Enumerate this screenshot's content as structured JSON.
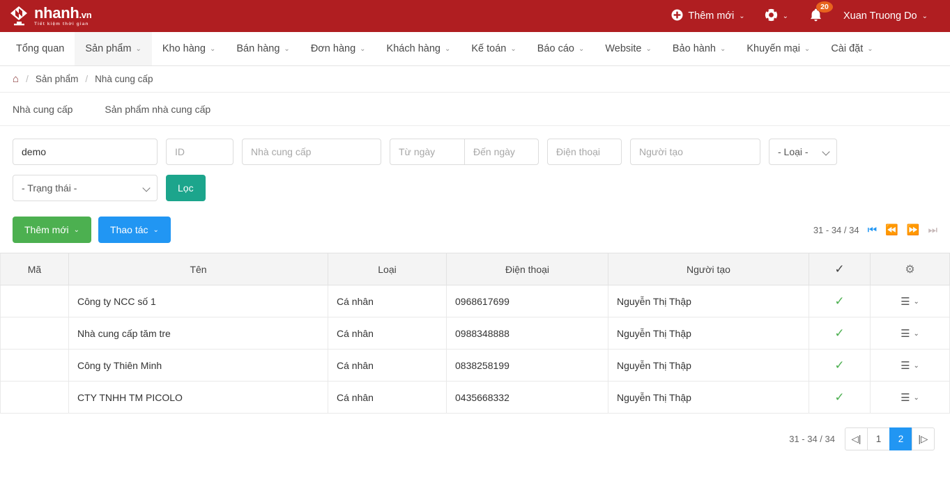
{
  "brand": {
    "name": "nhanh",
    "tld": ".vn",
    "tagline": "Tiết kiệm thời gian",
    "header_color": "#b01e21"
  },
  "header": {
    "add_new_label": "Thêm mới",
    "help_icon": "lifebuoy-icon",
    "bell_icon": "bell-icon",
    "notification_count": "20",
    "user_name": "Xuan Truong Do",
    "badge_color": "#e8641e"
  },
  "mainnav": {
    "items": [
      {
        "label": "Tổng quan",
        "has_caret": false,
        "active": false
      },
      {
        "label": "Sản phẩm",
        "has_caret": true,
        "active": true
      },
      {
        "label": "Kho hàng",
        "has_caret": true,
        "active": false
      },
      {
        "label": "Bán hàng",
        "has_caret": true,
        "active": false
      },
      {
        "label": "Đơn hàng",
        "has_caret": true,
        "active": false
      },
      {
        "label": "Khách hàng",
        "has_caret": true,
        "active": false
      },
      {
        "label": "Kế toán",
        "has_caret": true,
        "active": false
      },
      {
        "label": "Báo cáo",
        "has_caret": true,
        "active": false
      },
      {
        "label": "Website",
        "has_caret": true,
        "active": false
      },
      {
        "label": "Bảo hành",
        "has_caret": true,
        "active": false
      },
      {
        "label": "Khuyến mại",
        "has_caret": true,
        "active": false
      },
      {
        "label": "Cài đặt",
        "has_caret": true,
        "active": false
      }
    ]
  },
  "breadcrumb": {
    "home_icon": "home-icon",
    "sep": "/",
    "item1": "Sản phẩm",
    "item2": "Nhà cung cấp"
  },
  "subtabs": {
    "tab1": "Nhà cung cấp",
    "tab2": "Sản phẩm nhà cung cấp"
  },
  "filters": {
    "keyword_value": "demo",
    "keyword_placeholder": "",
    "id_placeholder": "ID",
    "supplier_placeholder": "Nhà cung cấp",
    "from_date_placeholder": "Từ ngày",
    "to_date_placeholder": "Đến ngày",
    "phone_placeholder": "Điện thoại",
    "creator_placeholder": "Người tạo",
    "type_selected": "- Loại -",
    "status_selected": "- Trạng thái -",
    "filter_button": "Lọc",
    "filter_button_color": "#1ca58c"
  },
  "toolbar": {
    "add_new_label": "Thêm mới",
    "add_new_color": "#4cb050",
    "action_label": "Thao tác",
    "action_color": "#2196f3"
  },
  "pager_top": {
    "range": "31 - 34 / 34",
    "first_icon": "first-page-icon",
    "prev_icon": "prev-page-icon",
    "next_icon": "next-page-icon",
    "last_icon": "last-page-icon"
  },
  "table": {
    "columns": {
      "code": "Mã",
      "name": "Tên",
      "type": "Loại",
      "phone": "Điện thoại",
      "creator": "Người tạo",
      "status": "check-icon",
      "settings": "gear-icon"
    },
    "rows": [
      {
        "code": "",
        "name": "Công ty NCC số 1",
        "type": "Cá nhân",
        "phone": "0968617699",
        "creator": "Nguyễn Thị Thập",
        "status": "✓"
      },
      {
        "code": "",
        "name": "Nhà cung cấp tăm tre",
        "type": "Cá nhân",
        "phone": "0988348888",
        "creator": "Nguyễn Thị Thập",
        "status": "✓"
      },
      {
        "code": "",
        "name": "Công ty Thiên Minh",
        "type": "Cá nhân",
        "phone": "0838258199",
        "creator": "Nguyễn Thị Thập",
        "status": "✓"
      },
      {
        "code": "",
        "name": "CTY TNHH TM PICOLO",
        "type": "Cá nhân",
        "phone": "0435668332",
        "creator": "Nguyễn Thị Thập",
        "status": "✓"
      }
    ]
  },
  "pager_bottom": {
    "range": "31 - 34 / 34",
    "first_label": "◁|",
    "page1": "1",
    "page2": "2",
    "last_label": "|▷",
    "active_page": "2",
    "active_color": "#2196f3"
  }
}
